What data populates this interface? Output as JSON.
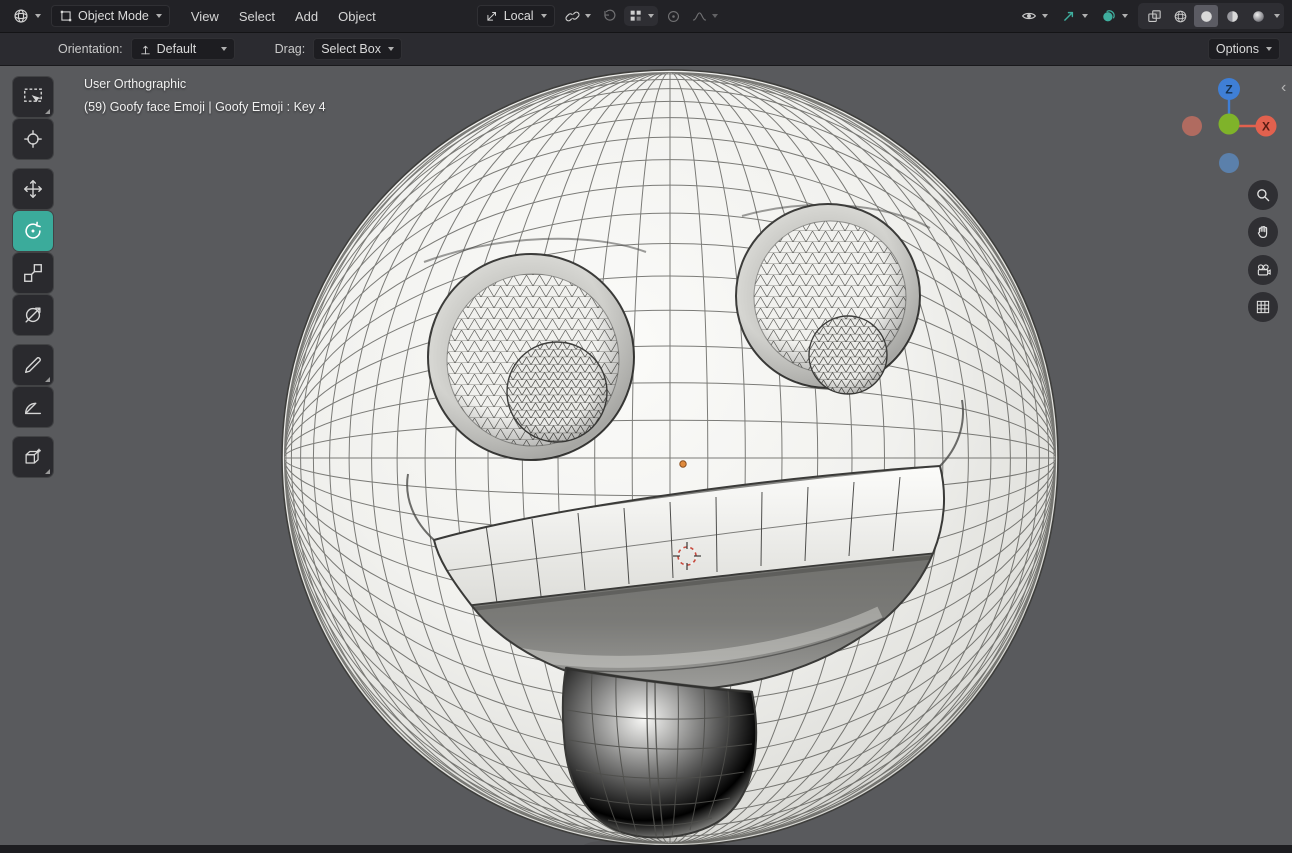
{
  "top_bar": {
    "editor_type": "3d-viewport",
    "mode_dropdown": {
      "label": "Object Mode"
    },
    "menus": [
      {
        "label": "View"
      },
      {
        "label": "Select"
      },
      {
        "label": "Add"
      },
      {
        "label": "Object"
      }
    ],
    "orientation_dropdown": {
      "label": "Local"
    }
  },
  "tool_settings_bar": {
    "orientation_label": "Orientation:",
    "orientation_value": "Default",
    "drag_label": "Drag:",
    "drag_value": "Select Box",
    "options_button": "Options"
  },
  "left_toolbar": {
    "active_tool": "rotate",
    "tools": [
      {
        "name": "tweak-select-box"
      },
      {
        "name": "cursor"
      },
      {
        "name": "move"
      },
      {
        "name": "rotate",
        "active": true
      },
      {
        "name": "scale"
      },
      {
        "name": "transform"
      },
      {
        "name": "annotate"
      },
      {
        "name": "measure"
      },
      {
        "name": "add-cube"
      }
    ]
  },
  "viewport": {
    "header_text_line1": "User Orthographic",
    "header_text_line2": "(59) Goofy face Emoji | Goofy Emoji : Key 4",
    "gizmo_axis_labels": {
      "z": "Z",
      "x": "X"
    }
  },
  "icons": {
    "top_center": [
      "transform-orientation-icon",
      "snap-link-icon",
      "undo-arrow-icon",
      "snap-grid-icon",
      "proportional-editing-icon",
      "falloff-curve-icon"
    ],
    "top_right": [
      "visibility-eye-icon",
      "gizmos-toggle-icon",
      "overlays-toggle-icon",
      "xray-icon",
      "wireframe-shading-icon",
      "solid-shading-icon",
      "material-shading-icon",
      "rendered-shading-icon"
    ],
    "viewport_side": [
      "zoom-icon",
      "pan-hand-icon",
      "camera-view-icon",
      "grid-ortho-icon"
    ]
  },
  "colors": {
    "active_tool_highlight": "#3bab9b",
    "toggle_enabled_teal": "#3fae9e",
    "axis_x_red": "#e2614e",
    "axis_y_green": "#7fb32a",
    "axis_z_blue": "#3f7fd6",
    "viewport_background": "#595a5d",
    "header_background": "#222226",
    "cursor_red": "#c84b3f",
    "origin_orange": "#e08a3c"
  }
}
